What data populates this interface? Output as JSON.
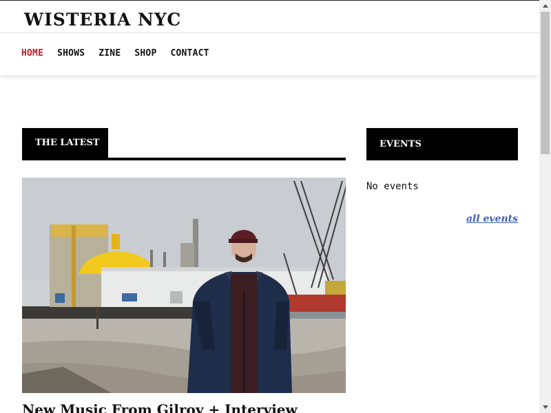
{
  "site": {
    "title": "WISTERIA NYC"
  },
  "nav": {
    "items": [
      {
        "label": "HOME",
        "active": true
      },
      {
        "label": "SHOWS",
        "active": false
      },
      {
        "label": "ZINE",
        "active": false
      },
      {
        "label": "SHOP",
        "active": false
      },
      {
        "label": "CONTACT",
        "active": false
      }
    ]
  },
  "latest": {
    "heading": "THE LATEST",
    "post": {
      "title": "New Music From Gilroy + Interview"
    }
  },
  "events": {
    "heading": "EVENTS",
    "empty_text": "No events",
    "all_link": "all events"
  },
  "colors": {
    "accent": "#b8202c",
    "link": "#3a5fb8",
    "header_bg": "#000000"
  }
}
